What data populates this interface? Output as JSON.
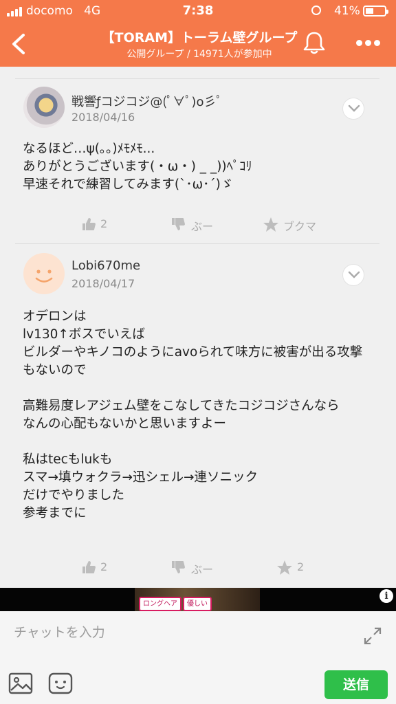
{
  "status_bar": {
    "carrier": "docomo",
    "network": "4G",
    "time": "7:38",
    "battery": "41%",
    "battery_level": 0.41
  },
  "header": {
    "title": "【TORAM】トーラム壁グループ",
    "subtitle": "公開グループ / 14971人が参加中",
    "back_icon": "chevron-left-icon",
    "bell_icon": "bell-icon",
    "more_icon": "more-dots-icon"
  },
  "posts": [
    {
      "user": "戦響ƒコジコジ@(ﾟ∀ﾟ)o彡ﾟ",
      "date": "2018/04/16",
      "body": "なるほど…ψ(｡｡)ﾒﾓﾒﾓ...\nありがとうございます(・ω・) _ _))ﾍﾟｺﾘ\n早速それで練習してみます(`･ω･´)ゞ",
      "like_count": "2",
      "dislike_label": "ぶー",
      "bookmark_label": "ブクマ"
    },
    {
      "user": "Lobi670me",
      "date": "2018/04/17",
      "body": "オデロンは\nlv130↑ボスでいえば\nビルダーやキノコのようにavoられて味方に被害が出る攻撃もないので\n\n高難易度レアジェム壁をこなしてきたコジコジさんなら\nなんの心配もないかと思いますよー\n\n私はtecもlukも\nスマ→填ウォクラ→迅シェル→連ソニック\nだけでやりました\n参考までに",
      "like_count": "2",
      "dislike_label": "ぶー",
      "bookmark_label": "2"
    }
  ],
  "ad": {
    "tags": [
      "ロングヘア",
      "優しい"
    ],
    "info_label": "i"
  },
  "input": {
    "placeholder": "チャットを入力",
    "value": "",
    "send_label": "送信"
  },
  "colors": {
    "accent": "#f5794a",
    "send": "#2fbf4a",
    "muted": "#aaaaaa"
  }
}
